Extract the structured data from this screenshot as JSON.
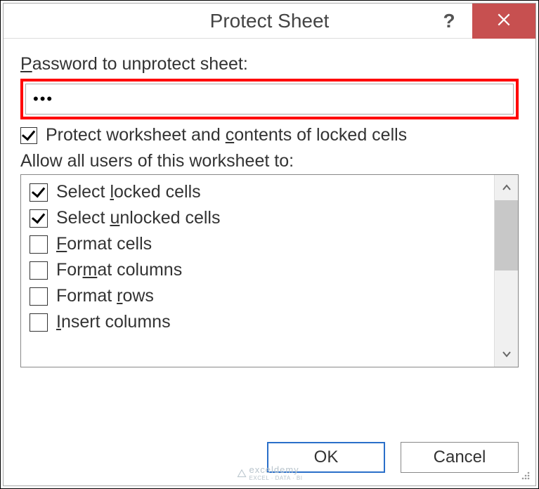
{
  "title": "Protect Sheet",
  "help": "?",
  "passwordLabel": {
    "pre": "P",
    "u": "",
    "post": "assword to unprotect sheet:",
    "underlineChar": "P"
  },
  "passwordLabelText": "Password to unprotect sheet:",
  "passwordValue": "•••",
  "protectCheckbox": {
    "checked": true,
    "text1": "Protect worksheet and ",
    "underline": "c",
    "text2": "ontents of locked cells"
  },
  "allowLabel": "Allow all users of this worksheet to:",
  "permissions": [
    {
      "checked": true,
      "pre": "Select ",
      "u": "l",
      "post": "ocked cells"
    },
    {
      "checked": true,
      "pre": "Select ",
      "u": "u",
      "post": "nlocked cells"
    },
    {
      "checked": false,
      "pre": "",
      "u": "F",
      "post": "ormat cells"
    },
    {
      "checked": false,
      "pre": "For",
      "u": "m",
      "post": "at columns"
    },
    {
      "checked": false,
      "pre": "Format ",
      "u": "r",
      "post": "ows"
    },
    {
      "checked": false,
      "pre": "",
      "u": "I",
      "post": "nsert columns"
    }
  ],
  "buttons": {
    "ok": "OK",
    "cancel": "Cancel"
  },
  "watermark": {
    "main": "exceldemy",
    "sub": "EXCEL · DATA · BI"
  }
}
